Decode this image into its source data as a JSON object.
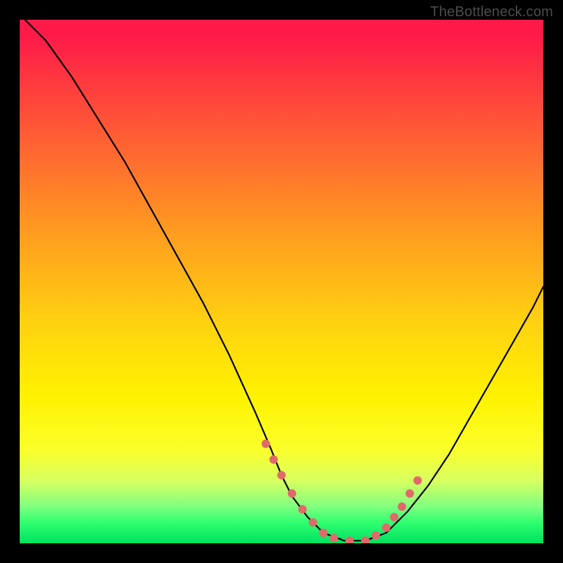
{
  "watermark": "TheBottleneck.com",
  "chart_data": {
    "type": "line",
    "title": "",
    "xlabel": "",
    "ylabel": "",
    "xlim": [
      0,
      100
    ],
    "ylim": [
      0,
      100
    ],
    "grid": false,
    "series": [
      {
        "name": "bottleneck-curve",
        "x": [
          1,
          5,
          10,
          15,
          20,
          25,
          30,
          35,
          40,
          45,
          48,
          50,
          52,
          55,
          58,
          62,
          66,
          70,
          74,
          78,
          82,
          86,
          90,
          94,
          98,
          100
        ],
        "y": [
          100,
          96,
          89,
          81,
          73,
          64,
          55,
          46,
          36,
          25,
          18,
          13,
          9,
          5,
          2,
          0.5,
          0.5,
          2,
          6,
          11,
          17,
          24,
          31,
          38,
          45,
          49
        ]
      }
    ],
    "markers": {
      "name": "highlight-points",
      "x": [
        47,
        48.5,
        50,
        52,
        54,
        56,
        58,
        60,
        63,
        66,
        68,
        70,
        71.5,
        73,
        74.5,
        76
      ],
      "y": [
        19,
        16,
        13,
        9.5,
        6.5,
        4,
        2,
        1,
        0.5,
        0.5,
        1.5,
        3,
        5,
        7,
        9.5,
        12
      ]
    },
    "gradient_stops": [
      {
        "pos": 0,
        "color": "#ff1a4a"
      },
      {
        "pos": 12,
        "color": "#ff3a3f"
      },
      {
        "pos": 26,
        "color": "#ff6a30"
      },
      {
        "pos": 40,
        "color": "#ff9a20"
      },
      {
        "pos": 58,
        "color": "#ffd210"
      },
      {
        "pos": 72,
        "color": "#fff200"
      },
      {
        "pos": 88,
        "color": "#d8ff60"
      },
      {
        "pos": 96,
        "color": "#30ff70"
      },
      {
        "pos": 100,
        "color": "#00e060"
      }
    ]
  }
}
